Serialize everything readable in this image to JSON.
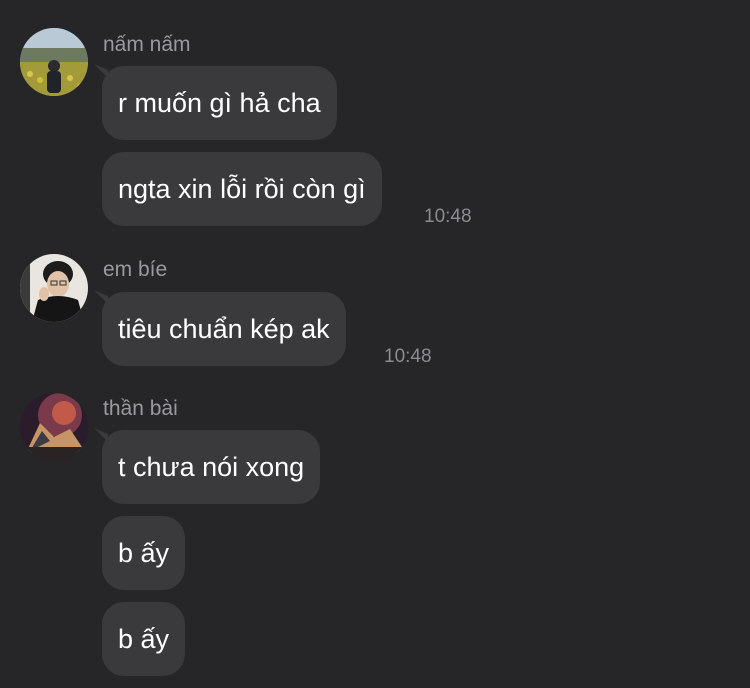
{
  "messages": [
    {
      "sender": "nấm nấm",
      "avatar": "avatar-nam-nam",
      "bubbles": [
        "r muốn gì hả cha",
        "ngta xin lỗi rồi còn gì"
      ],
      "time": "10:48"
    },
    {
      "sender": "em bíe",
      "avatar": "avatar-em-bie",
      "bubbles": [
        "tiêu chuẩn kép ak"
      ],
      "time": "10:48"
    },
    {
      "sender": "thần bài",
      "avatar": "avatar-than-bai",
      "bubbles": [
        "t chưa nói xong",
        "b ấy",
        "b ấy"
      ]
    }
  ],
  "colors": {
    "background": "#262628",
    "bubble": "#3a3a3c",
    "text": "#ffffff",
    "meta": "#9a9a9e"
  }
}
